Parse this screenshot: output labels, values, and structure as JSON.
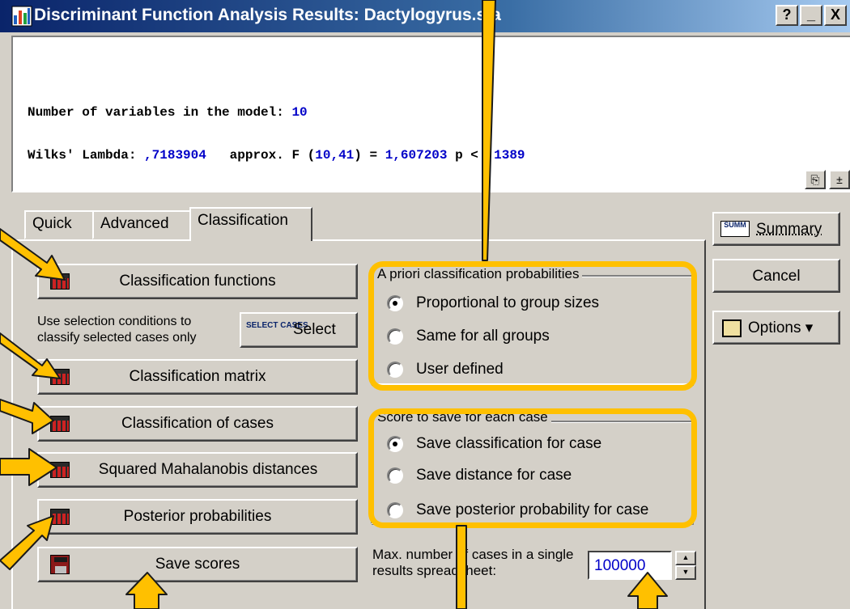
{
  "window": {
    "title": "Discriminant Function Analysis Results: Dactylogyrus.sta",
    "help_label": "?",
    "minimize_label": "_",
    "close_label": "X"
  },
  "output": {
    "line1_label": "Number of variables in the model: ",
    "line1_value": "10",
    "line2_label": "Wilks' Lambda: ",
    "line2_lambda": ",7183904",
    "line2_f_label": "   approx. F (",
    "line2_df": "10,41",
    "line2_eq": ") = ",
    "line2_f": "1,607203",
    "line2_p_label": " p < ",
    "line2_p": ",1389",
    "copy_icon_label": "⎘",
    "expand_label": "±"
  },
  "tabs": [
    "Quick",
    "Advanced",
    "Classification"
  ],
  "buttons": {
    "classification_functions": "Classification functions",
    "selection_note": "Use selection conditions to classify selected cases only",
    "select_icon_text": "SELECT CASES",
    "select": "Select",
    "classification_matrix": "Classification matrix",
    "classification_of_cases": "Classification of cases",
    "mahalanobis": "Squared Mahalanobis distances",
    "posterior": "Posterior probabilities",
    "save_scores": "Save scores"
  },
  "priors": {
    "title": "A priori classification probabilities",
    "options": [
      "Proportional to group sizes",
      "Same for all groups",
      "User defined"
    ],
    "selected": 0
  },
  "score": {
    "title": "Score to save for each case",
    "options": [
      "Save classification for case",
      "Save distance for case",
      "Save posterior probability for case"
    ],
    "selected": 0
  },
  "max_cases": {
    "label": "Max. number of cases in a single results spreadsheet:",
    "value": "100000"
  },
  "side": {
    "summary": "Summary",
    "summary_icon_text": "SUMM",
    "cancel": "Cancel",
    "options": "Options ▾"
  },
  "colors": {
    "face": "#d4d0c8",
    "title_start": "#0a246a",
    "value_blue": "#0000c8",
    "annotation": "#ffc000"
  }
}
